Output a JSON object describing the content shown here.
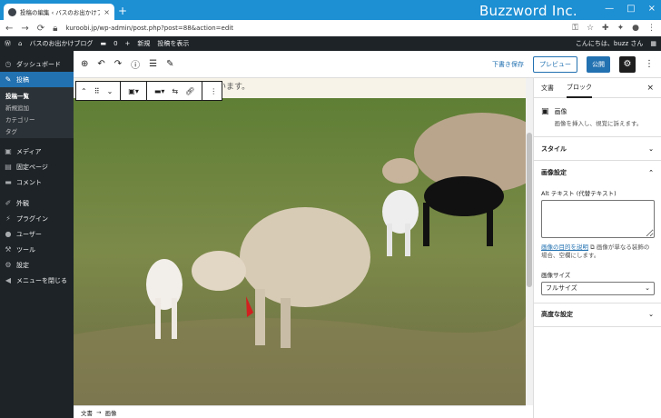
{
  "browser": {
    "tab_title": "投稿の編集 ‹ バスのお出かけブログ",
    "tab_close": "×",
    "new_tab": "+",
    "brand": "Buzzword Inc.",
    "url": "kuroobi.jp/wp-admin/post.php?post=88&action=edit",
    "window_controls": [
      "—",
      "□",
      "×"
    ]
  },
  "adminbar": {
    "site_name": "バスのお出かけブログ",
    "comments_count": "0",
    "new_label": "新規",
    "view_post": "投稿を表示",
    "greeting": "こんにちは、buzz さん"
  },
  "sidebar": {
    "items": [
      {
        "icon": "dashboard-icon",
        "glyph": "◷",
        "label": "ダッシュボード"
      },
      {
        "icon": "pin-icon",
        "glyph": "✎",
        "label": "投稿"
      },
      {
        "icon": "media-icon",
        "glyph": "▣",
        "label": "メディア"
      },
      {
        "icon": "page-icon",
        "glyph": "▤",
        "label": "固定ページ"
      },
      {
        "icon": "comment-icon",
        "glyph": "▬",
        "label": "コメント"
      },
      {
        "icon": "appearance-icon",
        "glyph": "✐",
        "label": "外観"
      },
      {
        "icon": "plugin-icon",
        "glyph": "⚡",
        "label": "プラグイン"
      },
      {
        "icon": "user-icon",
        "glyph": "●",
        "label": "ユーザー"
      },
      {
        "icon": "tools-icon",
        "glyph": "⚒",
        "label": "ツール"
      },
      {
        "icon": "settings-icon",
        "glyph": "⚙",
        "label": "設定"
      },
      {
        "icon": "collapse-icon",
        "glyph": "◀",
        "label": "メニューを閉じる"
      }
    ],
    "submenu": [
      "投稿一覧",
      "新規追加",
      "カテゴリー",
      "タグ"
    ]
  },
  "editor": {
    "draft_save": "下書き保存",
    "preview": "プレビュー",
    "publish": "公開",
    "paragraph_text": "…てみたいと思います。",
    "footer_doc": "文書",
    "footer_arrow": "→",
    "footer_block": "画像"
  },
  "panel": {
    "tab_document": "文書",
    "tab_block": "ブロック",
    "close": "×",
    "block_title": "画像",
    "block_desc": "画像を挿入し、視覚に訴えます。",
    "style_section": "スタイル",
    "image_settings": "画像設定",
    "alt_label": "Alt テキスト (代替テキスト)",
    "alt_help_link": "画像の目的を説明",
    "alt_help_rest": "画像が単なる装飾の場合、空欄にします。",
    "size_label": "画像サイズ",
    "size_value": "フルサイズ",
    "advanced": "高度な設定"
  },
  "colors": {
    "titlebar": "#1d8fd3",
    "admin_dark": "#1d2327",
    "accent": "#2271b1"
  }
}
